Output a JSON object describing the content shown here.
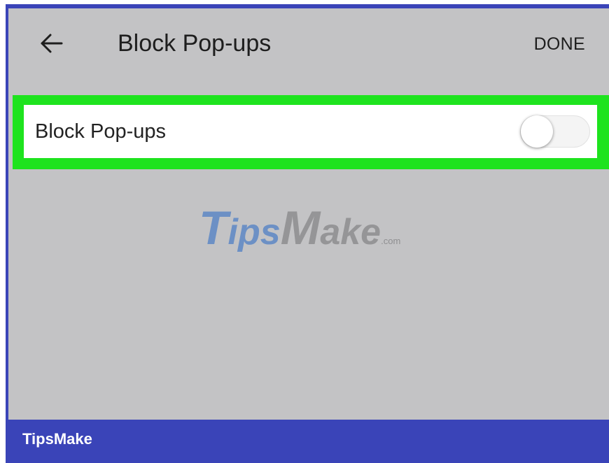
{
  "app_bar": {
    "back_icon": "arrow-left-icon",
    "title": "Block Pop-ups",
    "done_label": "DONE"
  },
  "setting": {
    "label": "Block Pop-ups",
    "toggle_on": false
  },
  "watermark": {
    "t": "T",
    "ips": "ips",
    "m": "M",
    "ake": "ake",
    "com": ".com"
  },
  "footer": {
    "brand": "TipsMake"
  },
  "colors": {
    "frame": "#3a44b8",
    "screen_background": "#c3c3c5",
    "highlight": "#1ee31e",
    "row_background": "#ffffff"
  }
}
